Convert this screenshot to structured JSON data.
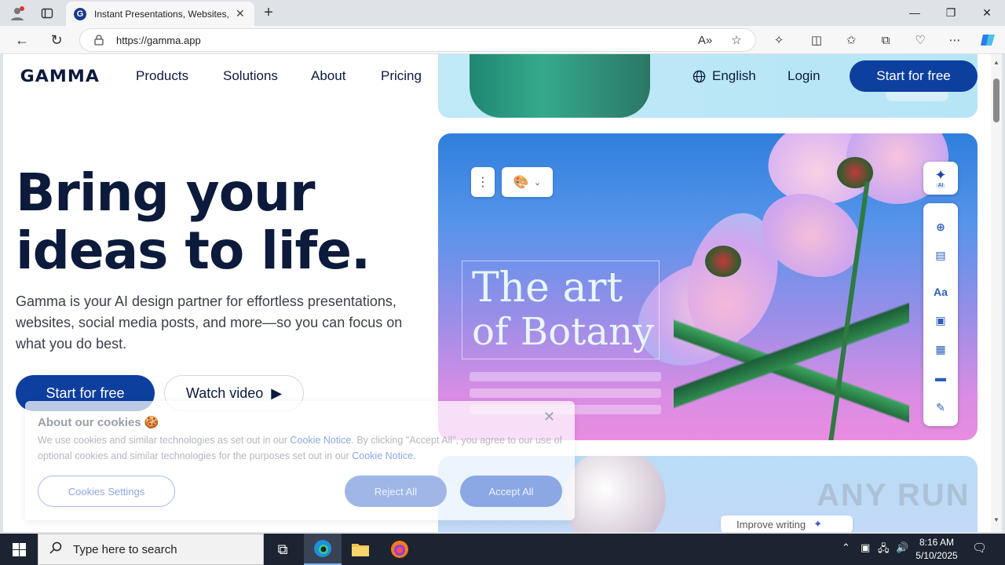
{
  "browser": {
    "tab_title": "Instant Presentations, Websites, a",
    "url": "https://gamma.app",
    "new_tab_label": "+",
    "tab_close": "✕"
  },
  "nav": {
    "logo": "GAMMA",
    "links": [
      "Products",
      "Solutions",
      "About",
      "Pricing"
    ],
    "language": "English",
    "login": "Login",
    "cta": "Start for free"
  },
  "hero": {
    "headline_line1": "Bring your",
    "headline_line2": "ideas to life.",
    "subtext": "Gamma is your AI design partner for effortless presentations, websites, social media posts, and more—so you can focus on what you do best.",
    "cta_primary": "Start for free",
    "cta_secondary": "Watch video"
  },
  "card": {
    "title_line1": "The art",
    "title_line2": "of Botany",
    "ai_tag": "AI",
    "improve_writing": "Improve writing"
  },
  "cookie": {
    "heading": "About our cookies 🍪",
    "body_part1": "We use cookies and similar technologies as set out in our ",
    "link1": "Cookie Notice",
    "body_part2": ". By clicking \"Accept All\", you agree to our use of optional cookies and similar technologies for the purposes set out in our ",
    "link2": "Cookie Notice",
    "body_part3": ".",
    "settings_label": "Cookies Settings",
    "reject_label": "Reject All",
    "accept_label": "Accept All"
  },
  "watermark": "ANY RUN",
  "taskbar": {
    "search_placeholder": "Type here to search",
    "time": "8:16 AM",
    "date": "5/10/2025"
  },
  "colors": {
    "brand_navy": "#0d3f9f",
    "text_dark": "#0c1a3c",
    "taskbar_bg": "#1c2331"
  }
}
